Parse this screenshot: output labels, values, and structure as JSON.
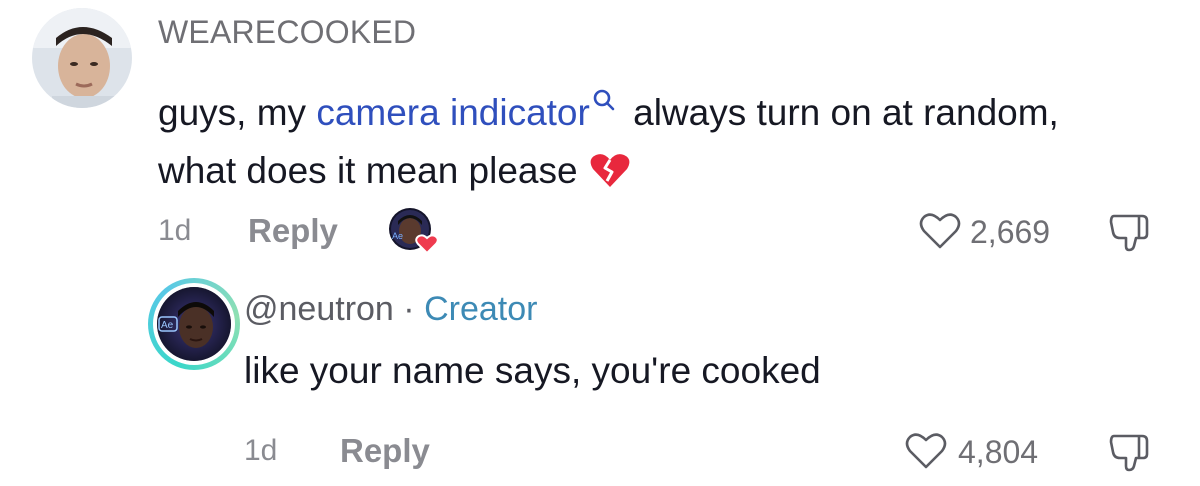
{
  "comment": {
    "username": "WEARECOOKED",
    "text_before_link": "guys, my ",
    "link_text": "camera indicator",
    "text_after_link": " always turn on at random, what does it mean please",
    "emoji_icon": "broken-heart-icon",
    "time": "1d",
    "reply_label": "Reply",
    "likes": "2,669",
    "liked_by_creator_icon": "creator-avatar-heart-icon"
  },
  "reply": {
    "handle": "@neutron",
    "separator": " · ",
    "badge": "Creator",
    "text": "like your name says, you're cooked",
    "time": "1d",
    "reply_label": "Reply",
    "likes": "4,804"
  },
  "colors": {
    "link": "#2f4fbd",
    "creator_badge": "#3d8ab5",
    "muted": "#8a8b91",
    "heart_red": "#ef3b4f"
  }
}
